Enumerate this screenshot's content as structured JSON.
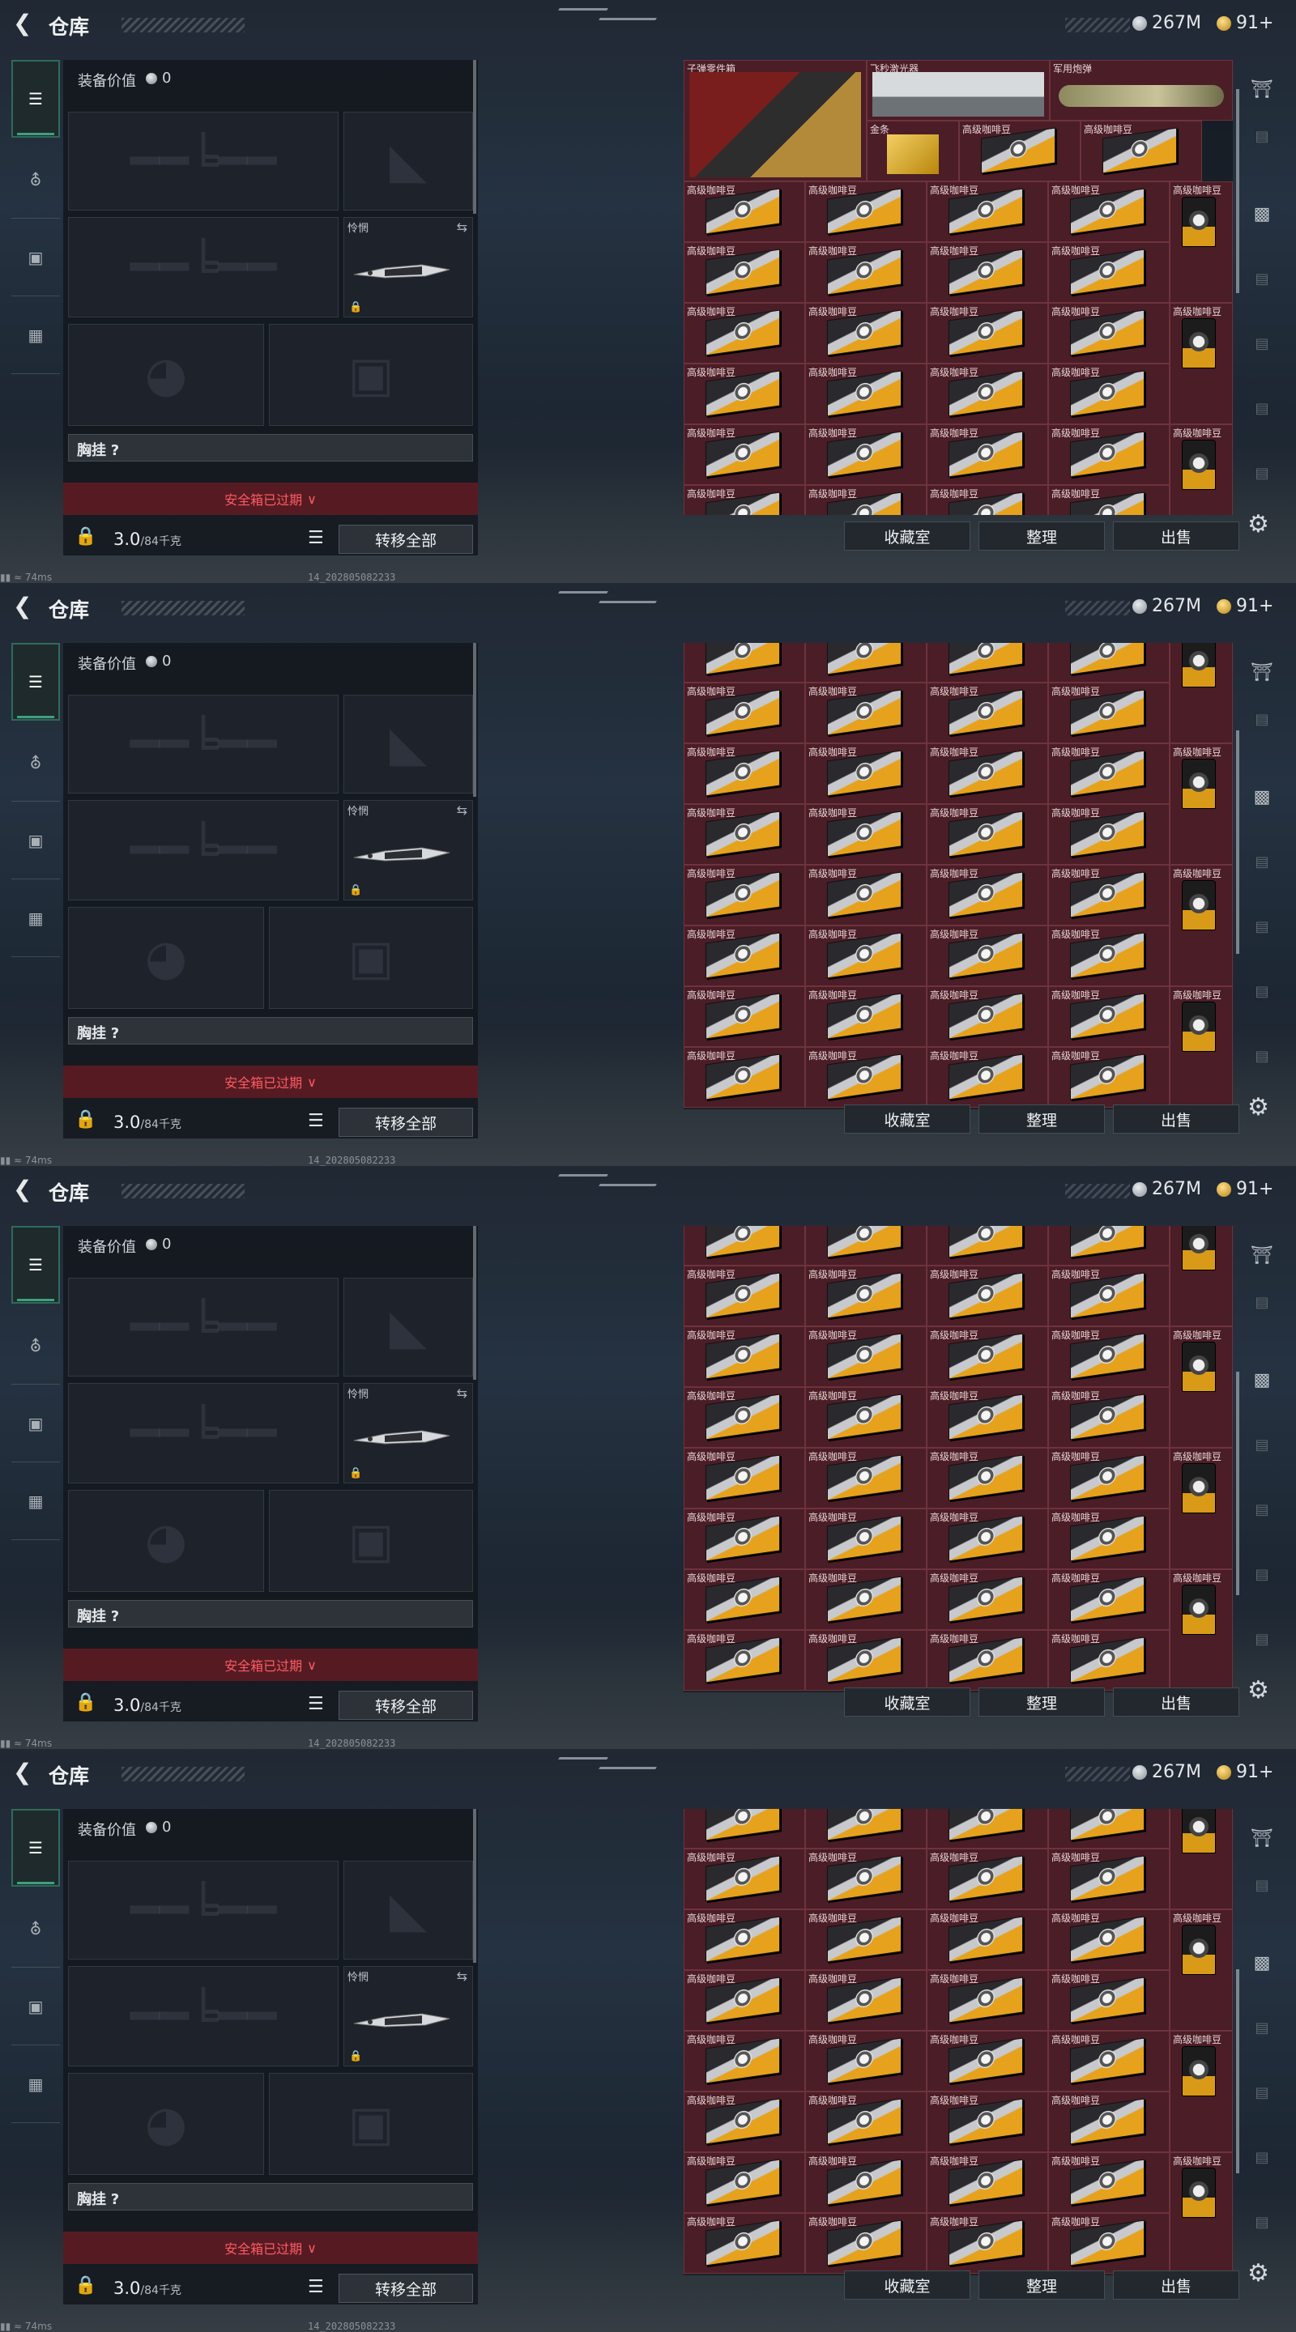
{
  "header": {
    "title": "仓库",
    "silver": "267M",
    "gold": "91+"
  },
  "equipment": {
    "value_label": "装备价值",
    "value": "0",
    "melee_label": "怜惘",
    "rig_label": "胸挂",
    "rig_value": "?",
    "safebox_label": "安全箱已过期",
    "weight": "3.0",
    "weight_max": "/84千克",
    "transfer_label": "转移全部"
  },
  "actions": {
    "collection": "收藏室",
    "sort": "整理",
    "sell": "出售"
  },
  "footer": {
    "ping": "74ms",
    "build": "14_202805082233"
  },
  "inventory": {
    "top_items": [
      "子弹零件箱",
      "飞秒激光器",
      "军用炮弹",
      "金条"
    ],
    "coffee_label": "高级咖啡豆"
  },
  "icons": {
    "back": "back-arrow-icon",
    "settings": "gear-icon"
  },
  "colors": {
    "cell": "#4b1d26",
    "safebox": "#561b22",
    "accent": "#3ea07f"
  }
}
